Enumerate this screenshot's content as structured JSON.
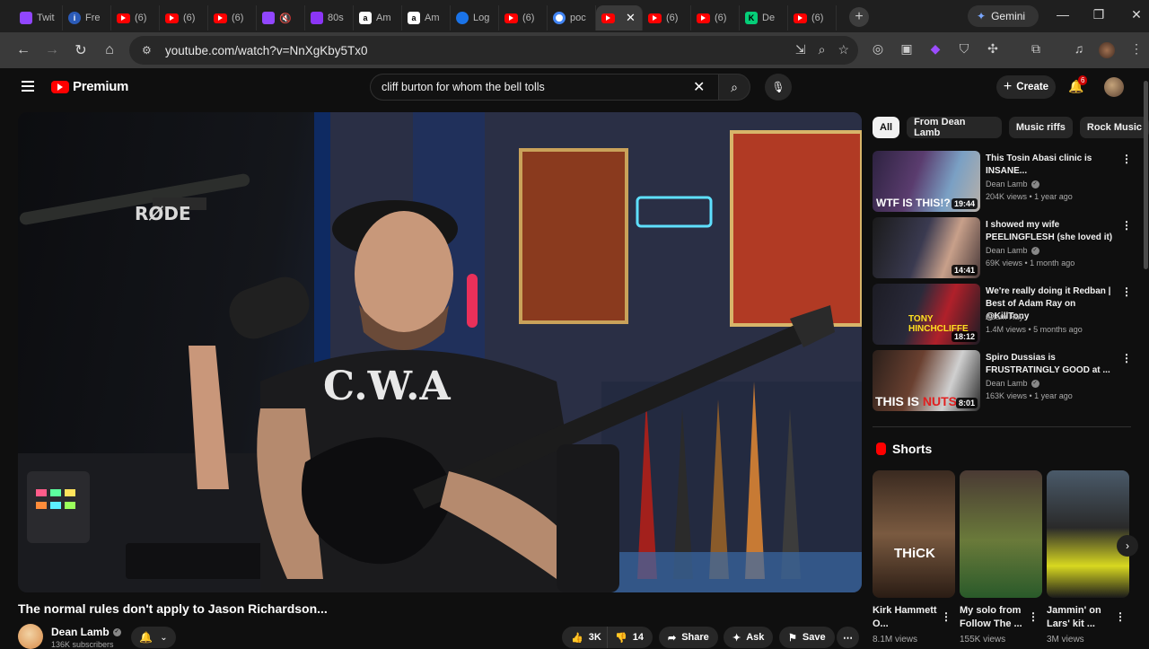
{
  "browser": {
    "tabs": [
      {
        "title": "Twit",
        "icon": "twitch-icon"
      },
      {
        "title": "Fre",
        "icon": "info-icon"
      },
      {
        "title": "(6)",
        "icon": "youtube-icon"
      },
      {
        "title": "(6)",
        "icon": "youtube-icon"
      },
      {
        "title": "(6)",
        "icon": "youtube-icon"
      },
      {
        "title": "",
        "icon": "twitch-icon"
      },
      {
        "title": "80s",
        "icon": "podcast-icon"
      },
      {
        "title": "Am",
        "icon": "amazon-icon"
      },
      {
        "title": "Am",
        "icon": "amazon-icon"
      },
      {
        "title": "Log",
        "icon": "globe-icon"
      },
      {
        "title": "(6)",
        "icon": "youtube-icon"
      },
      {
        "title": "poc",
        "icon": "google-icon"
      },
      {
        "title": "",
        "icon": "youtube-icon",
        "active": true
      },
      {
        "title": "(6)",
        "icon": "youtube-icon"
      },
      {
        "title": "(6)",
        "icon": "youtube-icon"
      },
      {
        "title": "De",
        "icon": "kick-icon"
      },
      {
        "title": "(6)",
        "icon": "youtube-icon"
      }
    ],
    "new_tab": "+",
    "gemini_label": "Gemini",
    "url": "youtube.com/watch?v=NnXgKby5Tx0"
  },
  "header": {
    "logo_text": "Premium",
    "search_value": "cliff burton for whom the bell tolls",
    "create_label": "Create",
    "notification_count": "6"
  },
  "video": {
    "title": "The normal rules don't apply to Jason Richardson...",
    "channel": "Dean Lamb",
    "subscribers": "136K subscribers",
    "likes": "3K",
    "dislikes": "14",
    "share_label": "Share",
    "ask_label": "Ask",
    "save_label": "Save"
  },
  "chips": [
    "All",
    "From Dean Lamb",
    "Music riffs",
    "Rock Music"
  ],
  "recommendations": [
    {
      "title": "This Tosin Abasi clinic is INSANE...",
      "channel": "Dean Lamb",
      "verified": true,
      "meta": "204K views • 1 year ago",
      "duration": "19:44"
    },
    {
      "title": "I showed my wife PEELINGFLESH (she loved it)",
      "channel": "Dean Lamb",
      "verified": true,
      "meta": "69K views • 1 month ago",
      "duration": "14:41"
    },
    {
      "title": "We're really doing it Redban | Best of Adam Ray on @KillTony",
      "channel": "Adam Ray",
      "verified": false,
      "meta": "1.4M views • 5 months ago",
      "duration": "18:12"
    },
    {
      "title": "Spiro Dussias is FRUSTRATINGLY GOOD at ...",
      "channel": "Dean Lamb",
      "verified": true,
      "meta": "163K views • 1 year ago",
      "duration": "8:01"
    }
  ],
  "shorts": {
    "heading": "Shorts",
    "items": [
      {
        "title": "Kirk Hammett O...",
        "views": "8.1M views"
      },
      {
        "title": "My solo from Follow The ...",
        "views": "155K views"
      },
      {
        "title": "Jammin' on Lars' kit ...",
        "views": "3M views"
      }
    ]
  }
}
